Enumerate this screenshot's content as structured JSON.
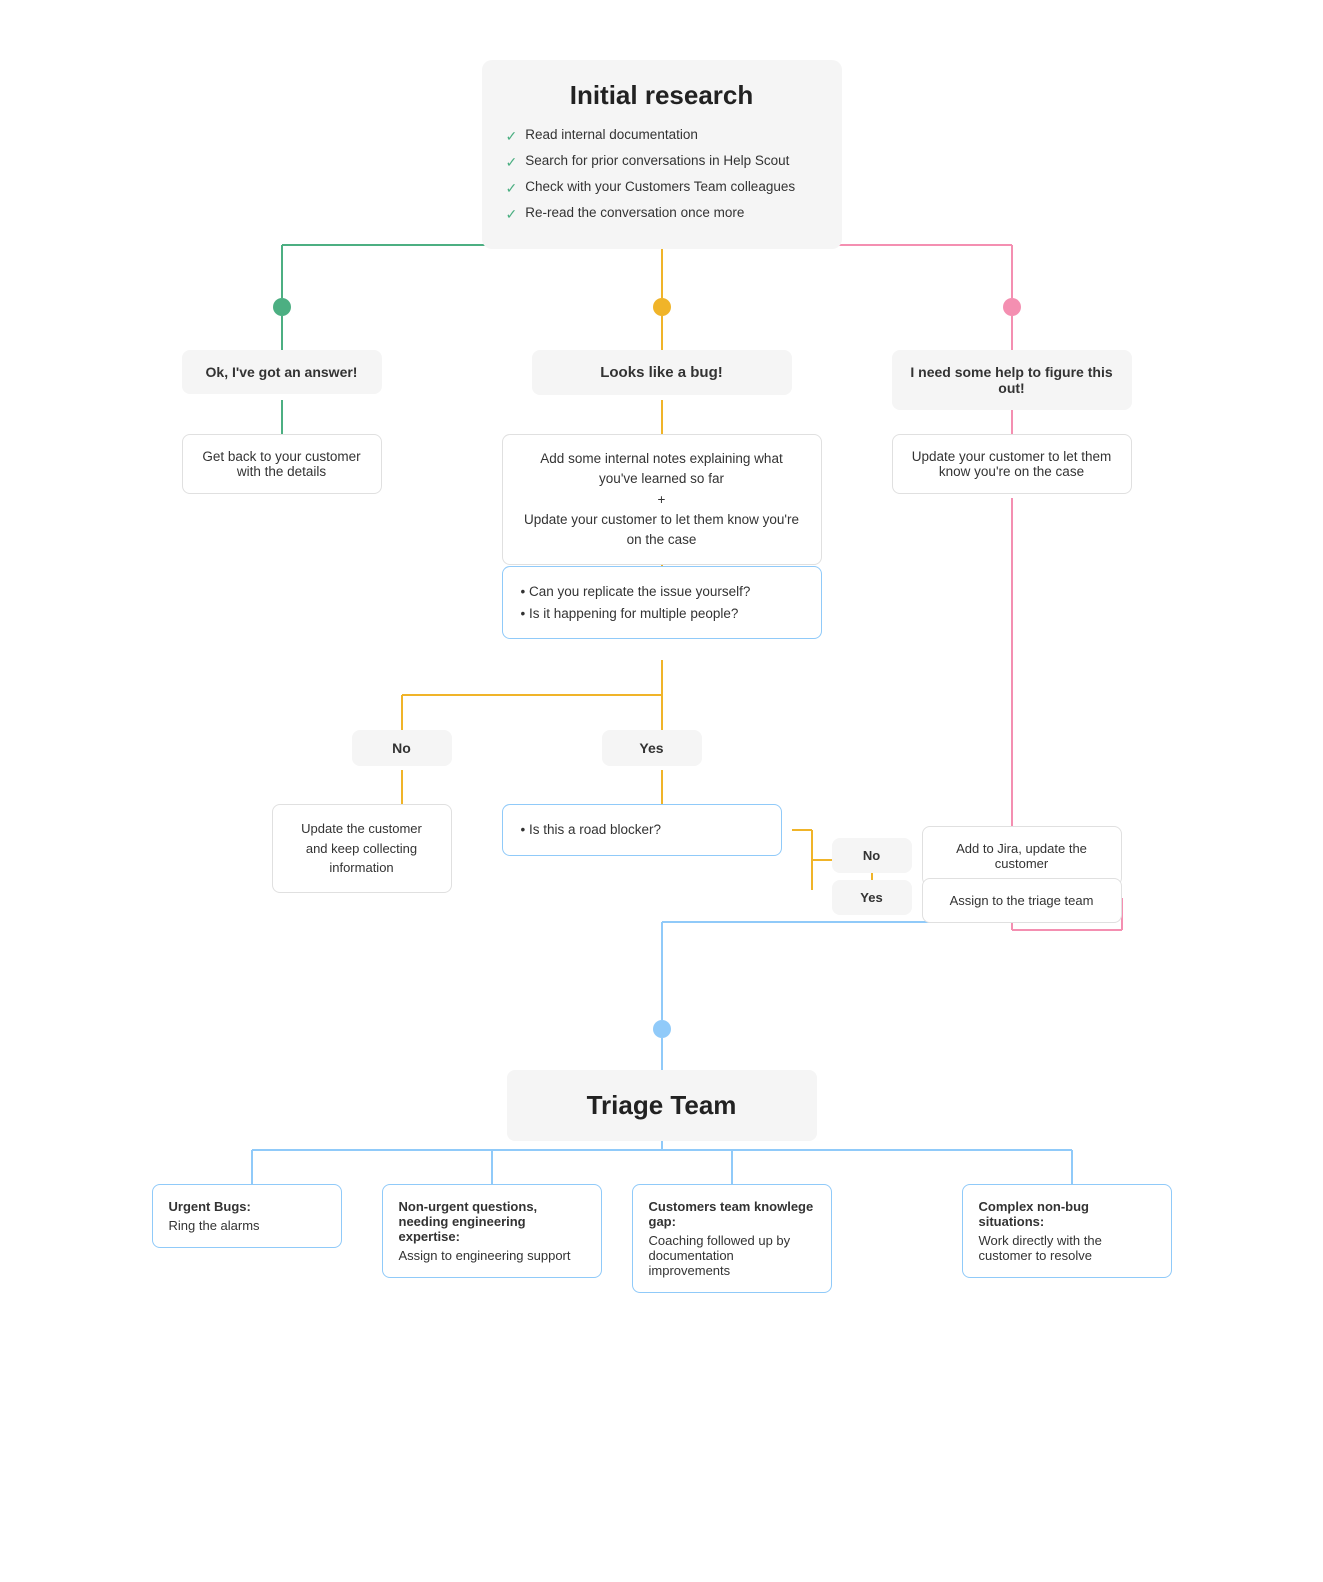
{
  "diagram": {
    "title": "Initial research",
    "checklist": [
      "Read internal documentation",
      "Search for prior conversations in Help Scout",
      "Check with your Customers Team colleagues",
      "Re-read the conversation once more"
    ],
    "outcome_left": {
      "label": "Ok, I've got an answer!",
      "sub": "Get back to your customer with the details"
    },
    "outcome_mid": {
      "label": "Looks like a bug!",
      "sub": "Add some internal notes explaining what you've learned so far\n+\nUpdate your customer to let them know you're on the case"
    },
    "outcome_right": {
      "label": "I need some help to figure this out!",
      "sub": "Update your customer to let them know you're on the case"
    },
    "bug_questions": "• Can you replicate the issue yourself?\n• Is it happening for multiple people?",
    "no_label": "No",
    "yes_label": "Yes",
    "no_result": "Update the customer and keep collecting information",
    "road_blocker": "• Is this a road blocker?",
    "no_jira": "Add to Jira, update the customer",
    "yes_triage": "Assign to the triage team",
    "triage_team": "Triage Team",
    "triage_items": [
      {
        "title": "Urgent Bugs:",
        "body": "Ring the alarms"
      },
      {
        "title": "Non-urgent questions, needing engineering expertise:",
        "body": "Assign to engineering support"
      },
      {
        "title": "Customers team knowlege gap:",
        "body": "Coaching followed up by documentation improvements"
      },
      {
        "title": "Complex non-bug situations:",
        "body": "Work directly with the customer to resolve"
      }
    ]
  }
}
